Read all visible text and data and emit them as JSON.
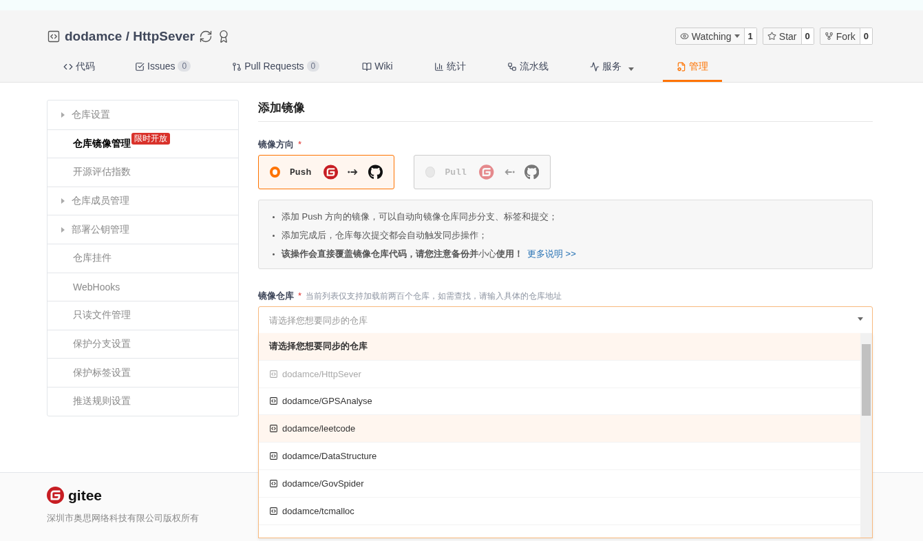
{
  "repo": {
    "owner": "dodamce",
    "separator": "/",
    "name": "HttpSever"
  },
  "social": [
    {
      "label": "Watching",
      "count": "1",
      "dropdown": true
    },
    {
      "label": "Star",
      "count": "0",
      "dropdown": false
    },
    {
      "label": "Fork",
      "count": "0",
      "dropdown": false
    }
  ],
  "tabs": [
    {
      "label": "代码",
      "selected": false,
      "dropdown": false
    },
    {
      "label": "Issues",
      "count": "0",
      "selected": false,
      "dropdown": false
    },
    {
      "label": "Pull Requests",
      "count": "0",
      "selected": false,
      "dropdown": false
    },
    {
      "label": "Wiki",
      "selected": false,
      "dropdown": false
    },
    {
      "label": "统计",
      "selected": false,
      "dropdown": false
    },
    {
      "label": "流水线",
      "selected": false,
      "dropdown": false
    },
    {
      "label": "服务",
      "selected": false,
      "dropdown": true
    },
    {
      "label": "管理",
      "selected": true,
      "dropdown": false
    }
  ],
  "sidebar": {
    "items": [
      {
        "label": "仓库设置",
        "expandable": true,
        "selected": false
      },
      {
        "label": "仓库镜像管理",
        "expandable": false,
        "selected": true,
        "badge": "限时开放"
      },
      {
        "label": "开源评估指数",
        "expandable": false,
        "selected": false
      },
      {
        "label": "仓库成员管理",
        "expandable": true,
        "selected": false
      },
      {
        "label": "部署公钥管理",
        "expandable": true,
        "selected": false
      },
      {
        "label": "仓库挂件",
        "expandable": false,
        "selected": false
      },
      {
        "label": "WebHooks",
        "expandable": false,
        "selected": false
      },
      {
        "label": "只读文件管理",
        "expandable": false,
        "selected": false
      },
      {
        "label": "保护分支设置",
        "expandable": false,
        "selected": false
      },
      {
        "label": "保护标签设置",
        "expandable": false,
        "selected": false
      },
      {
        "label": "推送规则设置",
        "expandable": false,
        "selected": false
      }
    ]
  },
  "form": {
    "title": "添加镜像",
    "direction": {
      "label": "镜像方向",
      "required": "*",
      "options": [
        {
          "label": "Push",
          "kind": "push",
          "selected": true,
          "disabled": false
        },
        {
          "label": "Pull",
          "kind": "pull",
          "selected": false,
          "disabled": true
        }
      ]
    },
    "notes": [
      {
        "text": "添加 Push 方向的镜像，可以自动向镜像仓库同步分支、标签和提交；"
      },
      {
        "text": "添加完成后，仓库每次提交都会自动触发同步操作；"
      },
      {
        "text": "**该操作会直接覆盖镜像仓库代码，请您注意备份并**小心**使用！**",
        "link": "更多说明 >>"
      }
    ],
    "repository": {
      "label": "镜像仓库",
      "required": "*",
      "hint": "当前列表仅支持加载前两百个仓库，如需查找，请输入具体的仓库地址",
      "placeholder": "请选择您想要同步的仓库",
      "expanded": true,
      "options": [
        {
          "label": "请选择您想要同步的仓库",
          "kind": "placeholder",
          "highlighted": true,
          "disabled": false
        },
        {
          "label": "dodamce/HttpSever",
          "kind": "repo",
          "highlighted": false,
          "disabled": true
        },
        {
          "label": "dodamce/GPSAnalyse",
          "kind": "repo",
          "highlighted": false,
          "disabled": false
        },
        {
          "label": "dodamce/leetcode",
          "kind": "repo",
          "highlighted": true,
          "disabled": false
        },
        {
          "label": "dodamce/DataStructure",
          "kind": "repo",
          "highlighted": false,
          "disabled": false
        },
        {
          "label": "dodamce/GovSpider",
          "kind": "repo",
          "highlighted": false,
          "disabled": false
        },
        {
          "label": "dodamce/tcmalloc",
          "kind": "repo",
          "highlighted": false,
          "disabled": false
        }
      ]
    }
  },
  "footer": {
    "brand": "gitee",
    "copyright": "深圳市奥思网络科技有限公司版权所有"
  }
}
